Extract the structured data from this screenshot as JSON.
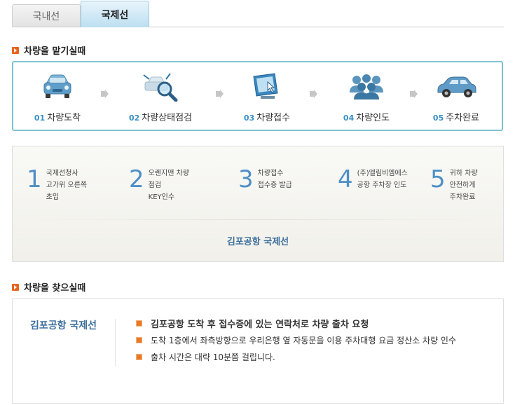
{
  "tabs": [
    {
      "label": "국내선",
      "active": false
    },
    {
      "label": "국제선",
      "active": true
    }
  ],
  "section1": {
    "title": "차량을 맡기실때"
  },
  "steps": [
    {
      "num": "01",
      "label": "차량도착",
      "icon": "car-front-icon"
    },
    {
      "num": "02",
      "label": "차량상태점검",
      "icon": "magnifier-inspection-icon"
    },
    {
      "num": "03",
      "label": "차량접수",
      "icon": "monitor-touch-icon"
    },
    {
      "num": "04",
      "label": "차량인도",
      "icon": "people-group-icon"
    },
    {
      "num": "05",
      "label": "주차완료",
      "icon": "car-side-icon"
    }
  ],
  "process": {
    "items": [
      {
        "num": "1",
        "lines": [
          "국제선청사",
          "고가위 오른쪽",
          "초입"
        ]
      },
      {
        "num": "2",
        "lines": [
          "오렌지맨 차량",
          "점검",
          "KEY인수"
        ]
      },
      {
        "num": "3",
        "lines": [
          "차량접수",
          "접수증 발급"
        ]
      },
      {
        "num": "4",
        "lines": [
          "(주)엘림비엠에스",
          "공항 주차장 인도"
        ]
      },
      {
        "num": "5",
        "lines": [
          "귀하 차량",
          "안전하게",
          "주차완료"
        ]
      }
    ],
    "caption": "김포공항 국제선"
  },
  "section2": {
    "title": "차량을 찾으실때"
  },
  "find": {
    "title": "김포공항 국제선",
    "items": [
      "김포공항 도착 후 접수증에 있는 연락처로 차량 출차 요청",
      "도착 1층에서 좌측방향으로 우리은행 옆 자동문을 이용 주차대행 요금 정산소 차량 인수",
      "출차 시간은 대략 10분쯤 걸립니다."
    ]
  },
  "colors": {
    "accent": "#3a8fc4",
    "orange": "#e8641e",
    "frame": "#7ec4d3"
  }
}
